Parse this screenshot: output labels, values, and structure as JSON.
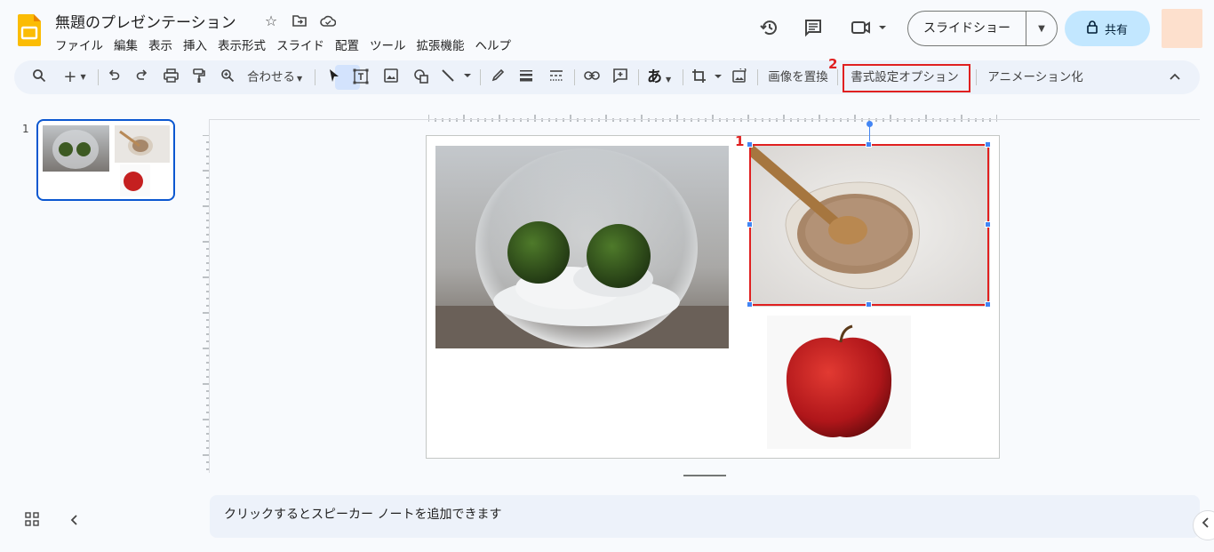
{
  "app": {
    "doc_title": "無題のプレゼンテーション"
  },
  "menu": [
    "ファイル",
    "編集",
    "表示",
    "挿入",
    "表示形式",
    "スライド",
    "配置",
    "ツール",
    "拡張機能",
    "ヘルプ"
  ],
  "header": {
    "slideshow_label": "スライドショー",
    "share_label": "共有"
  },
  "toolbar": {
    "fit_label": "合わせる",
    "replace_image_label": "画像を置換",
    "format_options_label": "書式設定オプション",
    "animate_label": "アニメーション化",
    "font_glyph": "あ"
  },
  "annotations": {
    "one": "1",
    "two": "2"
  },
  "filmstrip": {
    "slide_number": "1"
  },
  "notes": {
    "placeholder": "クリックするとスピーカー ノートを追加できます"
  },
  "colors": {
    "accent": "#0b57d0",
    "annotation_red": "#e02020",
    "share_bg": "#c2e7ff",
    "toolbar_bg": "#edf2fa"
  }
}
